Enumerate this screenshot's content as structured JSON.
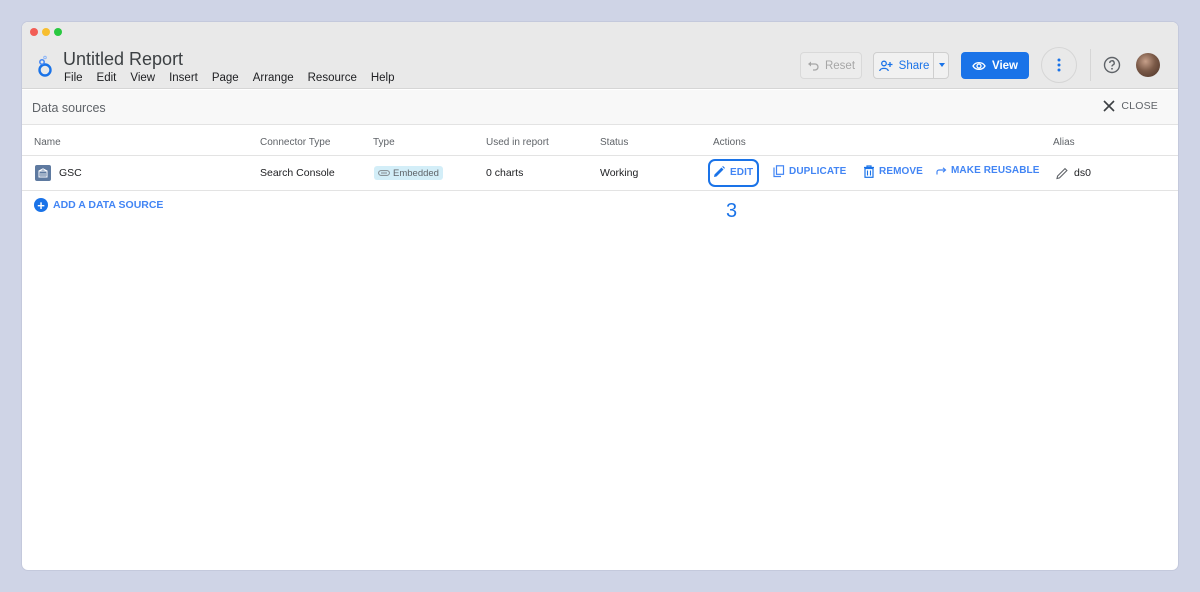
{
  "app": {
    "report_title": "Untitled Report",
    "menu": [
      "File",
      "Edit",
      "View",
      "Insert",
      "Page",
      "Arrange",
      "Resource",
      "Help"
    ]
  },
  "toolbar": {
    "reset_label": "Reset",
    "share_label": "Share",
    "view_label": "View"
  },
  "panel": {
    "title": "Data sources",
    "close_label": "CLOSE"
  },
  "table": {
    "headers": {
      "name": "Name",
      "connector_type": "Connector Type",
      "type": "Type",
      "used_in_report": "Used in report",
      "status": "Status",
      "actions": "Actions",
      "alias": "Alias"
    },
    "rows": [
      {
        "name": "GSC",
        "connector_type": "Search Console",
        "type": "Embedded",
        "used_in_report": "0 charts",
        "status": "Working",
        "alias": "ds0"
      }
    ],
    "actions": {
      "edit": "EDIT",
      "duplicate": "DUPLICATE",
      "remove": "REMOVE",
      "make_reusable": "MAKE REUSABLE"
    }
  },
  "add_data_source_label": "ADD A DATA SOURCE",
  "annotation": {
    "step_number": "3"
  },
  "colors": {
    "accent": "#1a73e8",
    "link": "#4285f4",
    "chip_bg": "#d3eef8",
    "backdrop": "#cfd4e6"
  }
}
